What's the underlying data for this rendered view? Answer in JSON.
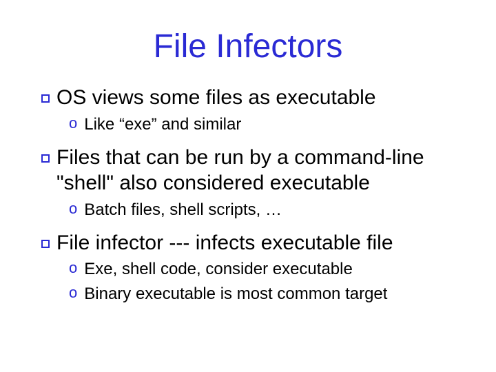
{
  "title": "File Infectors",
  "items": [
    {
      "text": "OS views some files as executable",
      "sub": [
        "Like “exe” and similar"
      ]
    },
    {
      "text": "Files that can be run by a command-line \"shell\" also considered executable",
      "sub": [
        "Batch files, shell scripts, …"
      ]
    },
    {
      "text": "File infector --- infects executable file",
      "sub": [
        "Exe, shell code, consider executable",
        "Binary executable is most common target"
      ]
    }
  ]
}
